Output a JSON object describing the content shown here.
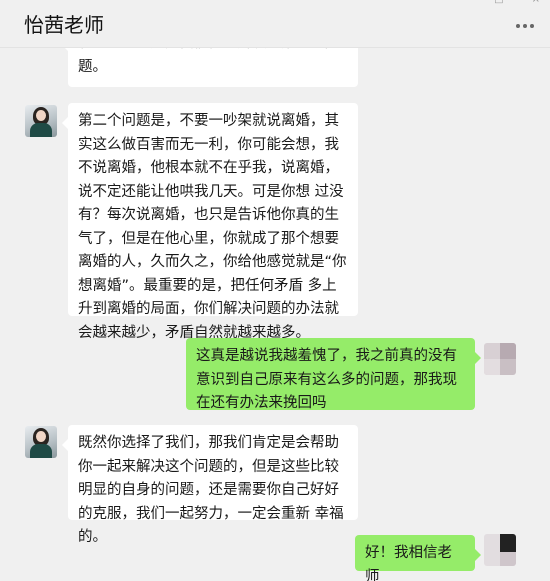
{
  "header": {
    "title": "怡茜老师",
    "window_controls": [
      "—",
      "□",
      "×"
    ]
  },
  "messages": [
    {
      "sender": "teacher",
      "text": "有意义吗？这是我们需要解决的第一个问题。"
    },
    {
      "sender": "teacher",
      "text": "第二个问题是，不要一吵架就说离婚，其实这么做百害而无一利，你可能会想，我不说离婚，他根本就不在乎我，说离婚，说不定还能让他哄我几天。可是你想 过没有？每次说离婚，也只是告诉他你真的生气了，但是在他心里，你就成了那个想要离婚的人，久而久之，你给他感觉就是“你想离婚”。最重要的是，把任何矛盾 多上升到离婚的局面，你们解决问题的办法就会越来越少，矛盾自然就越来越多。"
    },
    {
      "sender": "user",
      "text": "这真是越说我越羞愧了，我之前真的没有意识到自己原来有这么多的问题，那我现在还有办法来挽回吗"
    },
    {
      "sender": "teacher",
      "text": "既然你选择了我们，那我们肯定是会帮助你一起来解决这个问题的，但是这些比较明显的自身的问题，还是需要你自己好好的克服，我们一起努力，一定会重新 幸福的。"
    },
    {
      "sender": "user",
      "text": "好！我相信老师"
    }
  ],
  "colors": {
    "background": "#f0f0f0",
    "incoming_bubble": "#ffffff",
    "outgoing_bubble": "#95ec69"
  }
}
